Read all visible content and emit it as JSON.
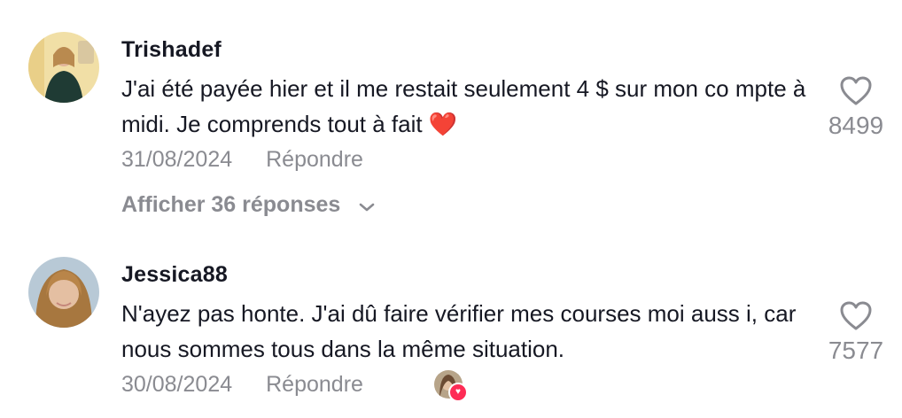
{
  "comments": [
    {
      "username": "Trishadef",
      "text": "J'ai été payée hier et il me restait seulement 4 $ sur mon co mpte à midi. Je comprends tout à fait",
      "emoji": "❤️",
      "date": "31/08/2024",
      "reply_label": "Répondre",
      "likes": "8499",
      "view_replies": "Afficher 36 réponses"
    },
    {
      "username": "Jessica88",
      "text": "N'ayez pas honte. J'ai dû faire vérifier mes courses moi auss i, car nous sommes tous dans la même situation.",
      "date": "30/08/2024",
      "reply_label": "Répondre",
      "likes": "7577"
    }
  ],
  "colors": {
    "muted": "#8a8b91",
    "text": "#161823",
    "creator_badge": "#fe2c55",
    "heart": "#e8112d"
  },
  "icons": {
    "like": "heart-outline-icon",
    "expand": "chevron-down-icon",
    "creator_like": "creator-liked-avatar-icon"
  }
}
